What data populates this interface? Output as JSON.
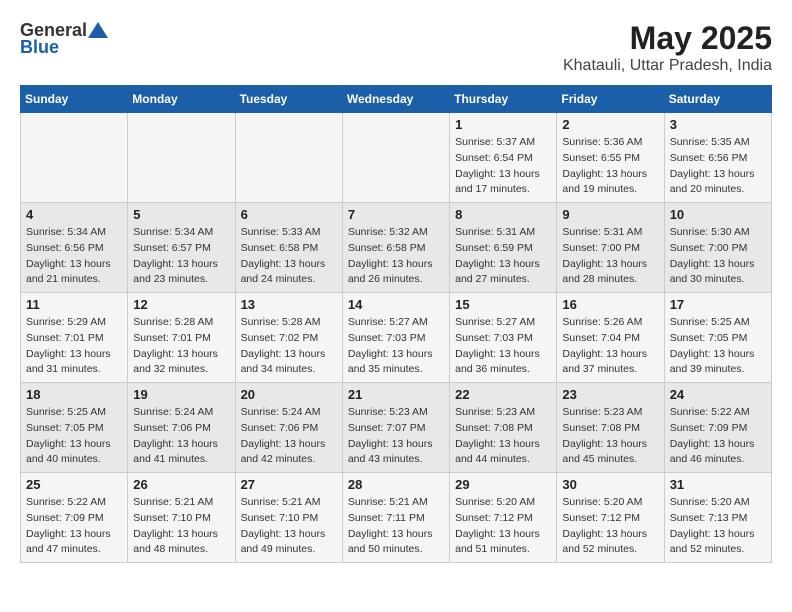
{
  "header": {
    "logo_general": "General",
    "logo_blue": "Blue",
    "title": "May 2025",
    "subtitle": "Khatauli, Uttar Pradesh, India"
  },
  "days_of_week": [
    "Sunday",
    "Monday",
    "Tuesday",
    "Wednesday",
    "Thursday",
    "Friday",
    "Saturday"
  ],
  "weeks": [
    [
      {
        "day": "",
        "info": ""
      },
      {
        "day": "",
        "info": ""
      },
      {
        "day": "",
        "info": ""
      },
      {
        "day": "",
        "info": ""
      },
      {
        "day": "1",
        "info": "Sunrise: 5:37 AM\nSunset: 6:54 PM\nDaylight: 13 hours\nand 17 minutes."
      },
      {
        "day": "2",
        "info": "Sunrise: 5:36 AM\nSunset: 6:55 PM\nDaylight: 13 hours\nand 19 minutes."
      },
      {
        "day": "3",
        "info": "Sunrise: 5:35 AM\nSunset: 6:56 PM\nDaylight: 13 hours\nand 20 minutes."
      }
    ],
    [
      {
        "day": "4",
        "info": "Sunrise: 5:34 AM\nSunset: 6:56 PM\nDaylight: 13 hours\nand 21 minutes."
      },
      {
        "day": "5",
        "info": "Sunrise: 5:34 AM\nSunset: 6:57 PM\nDaylight: 13 hours\nand 23 minutes."
      },
      {
        "day": "6",
        "info": "Sunrise: 5:33 AM\nSunset: 6:58 PM\nDaylight: 13 hours\nand 24 minutes."
      },
      {
        "day": "7",
        "info": "Sunrise: 5:32 AM\nSunset: 6:58 PM\nDaylight: 13 hours\nand 26 minutes."
      },
      {
        "day": "8",
        "info": "Sunrise: 5:31 AM\nSunset: 6:59 PM\nDaylight: 13 hours\nand 27 minutes."
      },
      {
        "day": "9",
        "info": "Sunrise: 5:31 AM\nSunset: 7:00 PM\nDaylight: 13 hours\nand 28 minutes."
      },
      {
        "day": "10",
        "info": "Sunrise: 5:30 AM\nSunset: 7:00 PM\nDaylight: 13 hours\nand 30 minutes."
      }
    ],
    [
      {
        "day": "11",
        "info": "Sunrise: 5:29 AM\nSunset: 7:01 PM\nDaylight: 13 hours\nand 31 minutes."
      },
      {
        "day": "12",
        "info": "Sunrise: 5:28 AM\nSunset: 7:01 PM\nDaylight: 13 hours\nand 32 minutes."
      },
      {
        "day": "13",
        "info": "Sunrise: 5:28 AM\nSunset: 7:02 PM\nDaylight: 13 hours\nand 34 minutes."
      },
      {
        "day": "14",
        "info": "Sunrise: 5:27 AM\nSunset: 7:03 PM\nDaylight: 13 hours\nand 35 minutes."
      },
      {
        "day": "15",
        "info": "Sunrise: 5:27 AM\nSunset: 7:03 PM\nDaylight: 13 hours\nand 36 minutes."
      },
      {
        "day": "16",
        "info": "Sunrise: 5:26 AM\nSunset: 7:04 PM\nDaylight: 13 hours\nand 37 minutes."
      },
      {
        "day": "17",
        "info": "Sunrise: 5:25 AM\nSunset: 7:05 PM\nDaylight: 13 hours\nand 39 minutes."
      }
    ],
    [
      {
        "day": "18",
        "info": "Sunrise: 5:25 AM\nSunset: 7:05 PM\nDaylight: 13 hours\nand 40 minutes."
      },
      {
        "day": "19",
        "info": "Sunrise: 5:24 AM\nSunset: 7:06 PM\nDaylight: 13 hours\nand 41 minutes."
      },
      {
        "day": "20",
        "info": "Sunrise: 5:24 AM\nSunset: 7:06 PM\nDaylight: 13 hours\nand 42 minutes."
      },
      {
        "day": "21",
        "info": "Sunrise: 5:23 AM\nSunset: 7:07 PM\nDaylight: 13 hours\nand 43 minutes."
      },
      {
        "day": "22",
        "info": "Sunrise: 5:23 AM\nSunset: 7:08 PM\nDaylight: 13 hours\nand 44 minutes."
      },
      {
        "day": "23",
        "info": "Sunrise: 5:23 AM\nSunset: 7:08 PM\nDaylight: 13 hours\nand 45 minutes."
      },
      {
        "day": "24",
        "info": "Sunrise: 5:22 AM\nSunset: 7:09 PM\nDaylight: 13 hours\nand 46 minutes."
      }
    ],
    [
      {
        "day": "25",
        "info": "Sunrise: 5:22 AM\nSunset: 7:09 PM\nDaylight: 13 hours\nand 47 minutes."
      },
      {
        "day": "26",
        "info": "Sunrise: 5:21 AM\nSunset: 7:10 PM\nDaylight: 13 hours\nand 48 minutes."
      },
      {
        "day": "27",
        "info": "Sunrise: 5:21 AM\nSunset: 7:10 PM\nDaylight: 13 hours\nand 49 minutes."
      },
      {
        "day": "28",
        "info": "Sunrise: 5:21 AM\nSunset: 7:11 PM\nDaylight: 13 hours\nand 50 minutes."
      },
      {
        "day": "29",
        "info": "Sunrise: 5:20 AM\nSunset: 7:12 PM\nDaylight: 13 hours\nand 51 minutes."
      },
      {
        "day": "30",
        "info": "Sunrise: 5:20 AM\nSunset: 7:12 PM\nDaylight: 13 hours\nand 52 minutes."
      },
      {
        "day": "31",
        "info": "Sunrise: 5:20 AM\nSunset: 7:13 PM\nDaylight: 13 hours\nand 52 minutes."
      }
    ]
  ]
}
